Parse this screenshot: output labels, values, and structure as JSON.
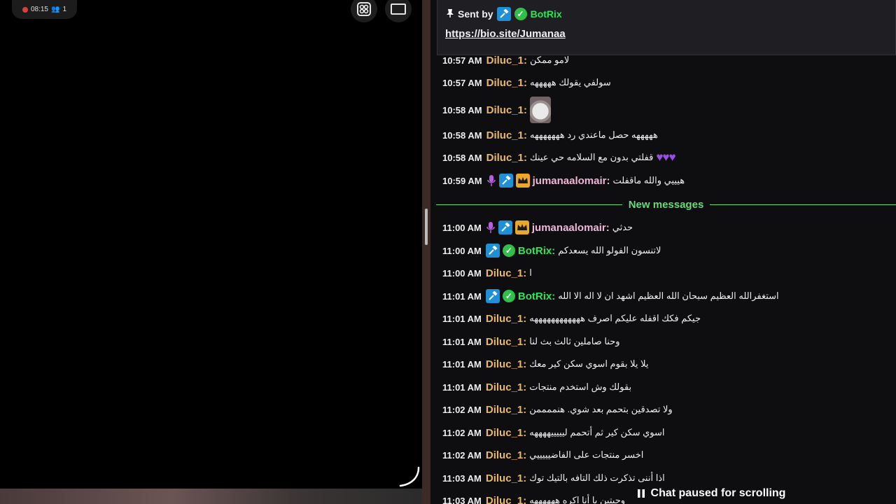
{
  "status_bar": {
    "time": "08:15",
    "viewers": "1"
  },
  "pinned": {
    "sent_by_label": "Sent by",
    "sender": "BotRix",
    "link": "https://bio.site/Jumanaa"
  },
  "messages": [
    {
      "time": "10:57 AM",
      "user": "Diluc_1:",
      "text": "لامو ممكن"
    },
    {
      "time": "10:57 AM",
      "user": "Diluc_1:",
      "text": "سولفي يقولك هههههه"
    },
    {
      "time": "10:58 AM",
      "user": "Diluc_1:",
      "text": ""
    },
    {
      "time": "10:58 AM",
      "user": "Diluc_1:",
      "text": "هههههه حصل ماعندي رد هههههههه"
    },
    {
      "time": "10:58 AM",
      "user": "Diluc_1:",
      "text": "قفلتي بدون مع السلامه حي عينك"
    },
    {
      "time": "10:59 AM",
      "user": "jumanaalomair:",
      "text": "هيييي والله ماقفلت"
    },
    {
      "time": "11:00 AM",
      "user": "jumanaalomair:",
      "text": "حدثي"
    },
    {
      "time": "11:00 AM",
      "user": "BotRix:",
      "text": "لاتنسون الفولو الله يسعدكم"
    },
    {
      "time": "11:00 AM",
      "user": "Diluc_1:",
      "text": "ا"
    },
    {
      "time": "11:01 AM",
      "user": "BotRix:",
      "text": "استغفرالله العظيم سبحان الله العظيم اشهد ان لا اله الا الله"
    },
    {
      "time": "11:01 AM",
      "user": "Diluc_1:",
      "text": "جيكم فكك اقفله عليكم اصرف ههههههههههههه"
    },
    {
      "time": "11:01 AM",
      "user": "Diluc_1:",
      "text": "وحنا صاملين ثالث بث لنا"
    },
    {
      "time": "11:01 AM",
      "user": "Diluc_1:",
      "text": "يلا يلا بقوم اسوي سكن كير معك"
    },
    {
      "time": "11:01 AM",
      "user": "Diluc_1:",
      "text": "بقولك وش استخدم منتجات"
    },
    {
      "time": "11:02 AM",
      "user": "Diluc_1:",
      "text": "ولا تصدقين بتحمم بعد شوي. هنممممن"
    },
    {
      "time": "11:02 AM",
      "user": "Diluc_1:",
      "text": "اسوي سكن كير ثم أتحمم ليييييههههه"
    },
    {
      "time": "11:02 AM",
      "user": "Diluc_1:",
      "text": "اخسر منتجات على الفاضيييييي"
    },
    {
      "time": "11:03 AM",
      "user": "Diluc_1:",
      "text": "اذا أنني تذكرت ذلك التافه بالتيك توك"
    },
    {
      "time": "11:03 AM",
      "user": "Diluc_1:",
      "text": "وحبتين يا أنا اكره ههههههه"
    }
  ],
  "new_messages_label": "New messages",
  "paused_label": "Chat paused for scrolling",
  "colors": {
    "diluc": "#e8b86a",
    "jumana": "#f0b8d8",
    "botrix": "#35e05a",
    "separator": "#6bd97a"
  }
}
